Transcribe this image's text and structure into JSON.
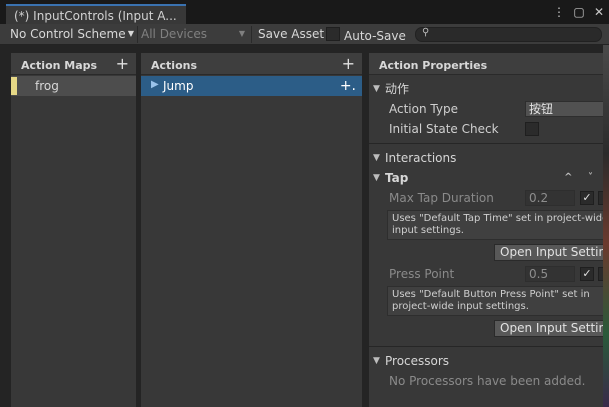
{
  "window": {
    "tab_title": "(*) InputControls (Input A...",
    "icons": [
      "more-icon",
      "maximize-icon",
      "close-icon"
    ]
  },
  "toolbar": {
    "control_scheme": "No Control Scheme",
    "devices": "All Devices",
    "save_asset": "Save Asset",
    "auto_save": "Auto-Save",
    "auto_save_checked": false,
    "search_placeholder": ""
  },
  "action_maps": {
    "header": "Action Maps",
    "items": [
      {
        "label": "frog",
        "selected": true
      }
    ]
  },
  "actions": {
    "header": "Actions",
    "items": [
      {
        "label": "Jump",
        "selected": true
      }
    ]
  },
  "properties": {
    "header": "Action Properties",
    "action_section": "动作",
    "action_type_label": "Action Type",
    "action_type_value": "按钮",
    "initial_state_label": "Initial State Check",
    "interactions_label": "Interactions",
    "tap_label": "Tap",
    "max_tap_label": "Max Tap Duration",
    "max_tap_value": "0.2",
    "max_tap_help_1": "Uses \"Default Tap Time\" set in project-wide",
    "max_tap_help_2": "input settings.",
    "open_settings_1": "Open Input Settin",
    "press_point_label": "Press Point",
    "press_point_value": "0.5",
    "press_help_1": "Uses \"Default Button Press Point\" set in",
    "press_help_2": "project-wide input settings.",
    "open_settings_2": "Open Input Settin",
    "processors_label": "Processors",
    "no_processors": "No Processors have been added."
  },
  "colors": {
    "selection": "#2c5d87",
    "map_marker": "#e6d886",
    "tab_accent": "#3a72b0"
  }
}
